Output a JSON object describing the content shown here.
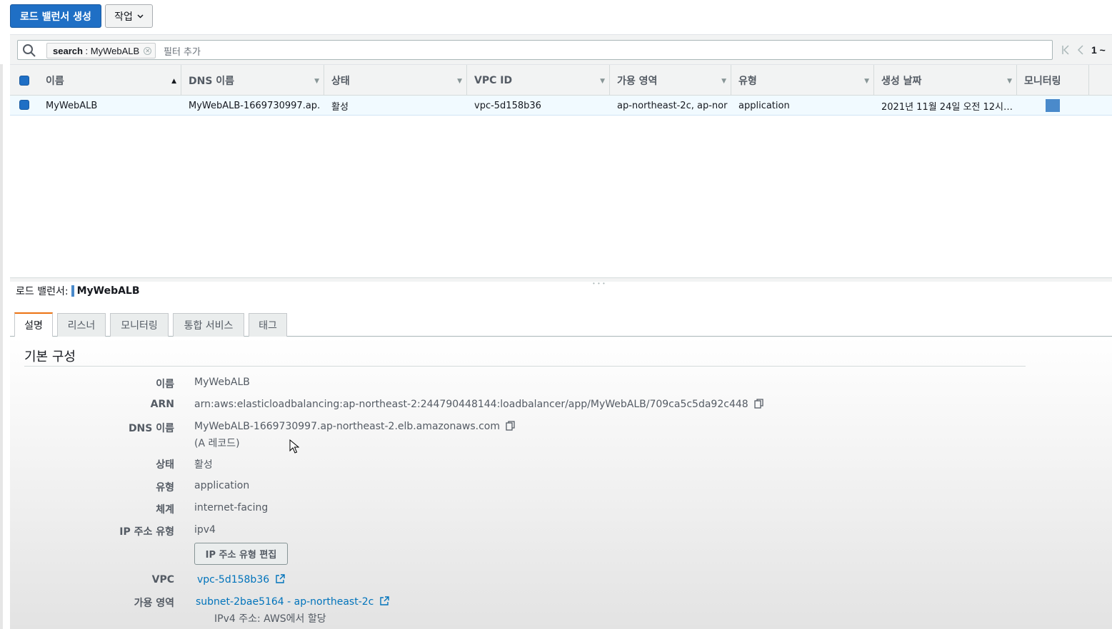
{
  "toolbar": {
    "create_button": "로드 밸런서 생성",
    "actions_button": "작업",
    "actions_icon": "chevron-down-icon"
  },
  "filter": {
    "token_key": "search",
    "token_sep": " : ",
    "token_value": "MyWebALB",
    "placeholder": "필터 추가"
  },
  "pagination": {
    "first_icon": "first-page-icon",
    "prev_icon": "prev-page-icon",
    "page_text": "1 ~"
  },
  "table": {
    "columns": [
      "이름",
      "DNS 이름",
      "상태",
      "VPC ID",
      "가용 영역",
      "유형",
      "생성 날짜",
      "모니터링"
    ],
    "sorted_column": "이름",
    "rows": [
      {
        "selected": true,
        "name": "MyWebALB",
        "dns": "MyWebALB-1669730997.ap…",
        "state": "활성",
        "vpc": "vpc-5d158b36",
        "az": "ap-northeast-2c, ap-nor…",
        "type": "application",
        "created": "2021년 11월 24일 오전 12시…"
      }
    ]
  },
  "detail": {
    "title_prefix": "로드 밸런서:",
    "title_name": "MyWebALB",
    "tabs": [
      "설명",
      "리스너",
      "모니터링",
      "통합 서비스",
      "태그"
    ],
    "active_tab": "설명",
    "section_title": "기본 구성",
    "fields": {
      "name_label": "이름",
      "name_value": "MyWebALB",
      "arn_label": "ARN",
      "arn_value": "arn:aws:elasticloadbalancing:ap-northeast-2:244790448144:loadbalancer/app/MyWebALB/709ca5c5da92c448",
      "dns_label": "DNS 이름",
      "dns_value": "MyWebALB-1669730997.ap-northeast-2.elb.amazonaws.com",
      "dns_note": "(A 레코드)",
      "state_label": "상태",
      "state_value": "활성",
      "type_label": "유형",
      "type_value": "application",
      "scheme_label": "체계",
      "scheme_value": "internet-facing",
      "ip_label": "IP 주소 유형",
      "ip_value": "ipv4",
      "ip_edit_button": "IP 주소 유형 편집",
      "vpc_label": "VPC",
      "vpc_value": "vpc-5d158b36",
      "az_label": "가용 영역",
      "az_value": "subnet-2bae5164 - ap-northeast-2c",
      "az_note": "IPv4 주소: AWS에서 할당"
    }
  },
  "colors": {
    "primary": "#1f6fc5",
    "link": "#0073bb",
    "active_tab_accent": "#ec7211",
    "selected_row": "#f1faff"
  }
}
